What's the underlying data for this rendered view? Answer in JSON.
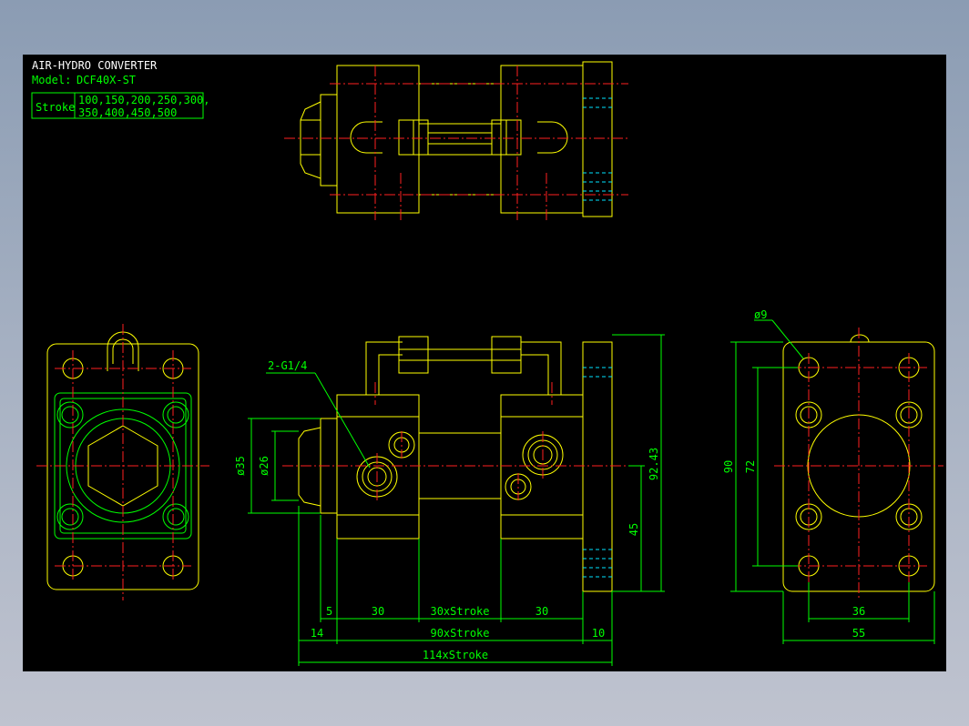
{
  "title_block": {
    "title": "AIR-HYDRO CONVERTER",
    "model_label": "Model:",
    "model_value": "DCF40X-ST",
    "stroke_label": "Stroke",
    "stroke_values_line1": "100,150,200,250,300,",
    "stroke_values_line2": "350,400,450,500"
  },
  "annotations": {
    "port_callout": "2-G1/4",
    "hole_callout": "ø9"
  },
  "dimensions": {
    "d35": "ø35",
    "d26": "ø26",
    "d5": "5",
    "d30a": "30",
    "d30stroke": "30xStroke",
    "d30b": "30",
    "d14": "14",
    "d90stroke": "90xStroke",
    "d10": "10",
    "d114stroke": "114xStroke",
    "d92_43": "92.43",
    "d45": "45",
    "d90": "90",
    "d72": "72",
    "d36": "36",
    "d55": "55"
  },
  "colors": {
    "background": "#000000",
    "outline": "#ffff00",
    "dimension": "#00ff00",
    "centerline": "#ff2020",
    "hidden": "#00e5ff",
    "text": "#ffffff"
  }
}
